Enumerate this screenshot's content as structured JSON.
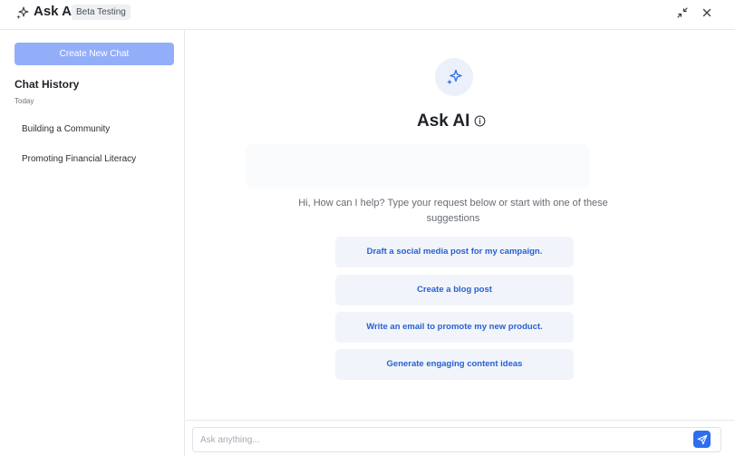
{
  "header": {
    "title": "Ask AI",
    "badge": "Beta Testing",
    "icons": [
      "sparkle-icon",
      "minimize-icon",
      "close-icon"
    ]
  },
  "sidebar": {
    "new_chat_label": "Create New Chat",
    "history_title": "Chat History",
    "groups": [
      {
        "label": "Today",
        "items": [
          {
            "label": "Building a Community"
          },
          {
            "label": "Promoting Financial Literacy"
          }
        ]
      }
    ]
  },
  "main": {
    "title": "Ask AI",
    "intro": "Hi, How can I help? Type your request below or start with one of these suggestions",
    "suggestions": [
      {
        "label": "Draft a social media post for my campaign."
      },
      {
        "label": "Create a blog post"
      },
      {
        "label": "Write an email to promote my new product."
      },
      {
        "label": "Generate engaging content ideas"
      }
    ]
  },
  "composer": {
    "placeholder": "Ask anything...",
    "value": ""
  },
  "colors": {
    "accent": "#2f6df0",
    "new_chat_button": "#93aef9",
    "suggestion_text": "#2a5fcf",
    "suggestion_bg": "#f1f5fb"
  }
}
